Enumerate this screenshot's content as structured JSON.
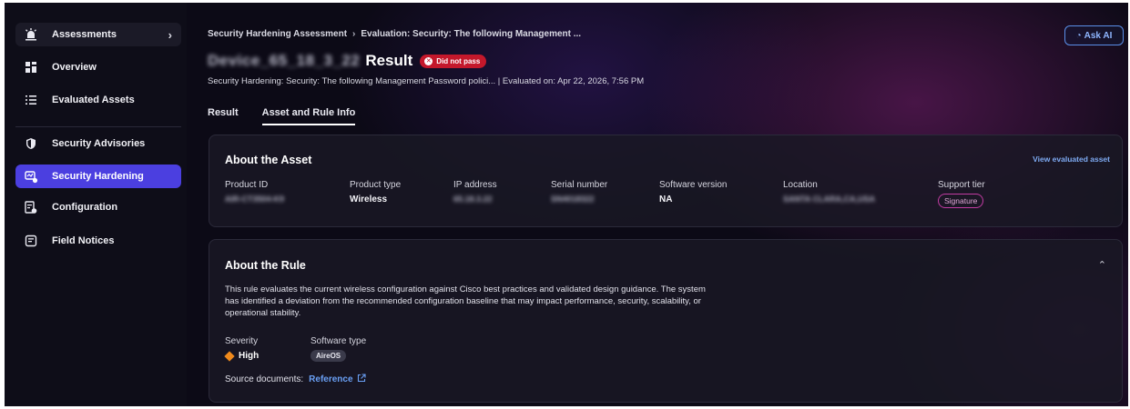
{
  "sidebar": {
    "items": [
      {
        "label": "Assessments",
        "icon": "assessment-icon"
      },
      {
        "label": "Overview",
        "icon": "dashboard-icon"
      },
      {
        "label": "Evaluated Assets",
        "icon": "list-icon"
      },
      {
        "label": "Security Advisories",
        "icon": "shield-icon"
      },
      {
        "label": "Security Hardening",
        "icon": "hardening-icon"
      },
      {
        "label": "Configuration",
        "icon": "config-icon"
      },
      {
        "label": "Field Notices",
        "icon": "notice-icon"
      }
    ],
    "active_index": 4,
    "accent_color": "#4b3fe0"
  },
  "header": {
    "breadcrumb": [
      "Security Hardening Assessment",
      "Evaluation: Security: The following Management ..."
    ],
    "breadcrumb_separator": "›",
    "device_name": "Device_65_18_3_22",
    "title_suffix": "Result",
    "status_badge": "Did not pass",
    "status_color": "#c4182b",
    "subline": "Security Hardening: Security: The following Management Password polici... | Evaluated on: Apr 22, 2026, 7:56 PM",
    "ask_ai": "Ask AI"
  },
  "tabs": [
    {
      "label": "Result",
      "active": false
    },
    {
      "label": "Asset and Rule Info",
      "active": true
    }
  ],
  "asset": {
    "title": "About the Asset",
    "view_link": "View evaluated asset",
    "fields": [
      {
        "label": "Product ID",
        "value": "AIR-CT3504-K9",
        "blurred": true
      },
      {
        "label": "Product type",
        "value": "Wireless",
        "blurred": false
      },
      {
        "label": "IP address",
        "value": "65.18.3.22",
        "blurred": true
      },
      {
        "label": "Serial number",
        "value": "SN4018322",
        "blurred": true
      },
      {
        "label": "Software version",
        "value": "NA",
        "blurred": false
      },
      {
        "label": "Location",
        "value": "SANTA CLARA,CA,USA",
        "blurred": true
      },
      {
        "label": "Support tier",
        "value": "Signature",
        "badge": true
      }
    ]
  },
  "rule": {
    "title": "About the Rule",
    "description": "This rule evaluates the current wireless configuration against Cisco best practices and validated design guidance. The system has identified a deviation from the recommended configuration baseline that may impact performance, security, scalability, or operational stability.",
    "severity_label": "Severity",
    "severity_value": "High",
    "severity_color": "#f08a1c",
    "software_type_label": "Software type",
    "software_type_value": "AireOS",
    "source_label": "Source documents:",
    "reference_link": "Reference"
  }
}
